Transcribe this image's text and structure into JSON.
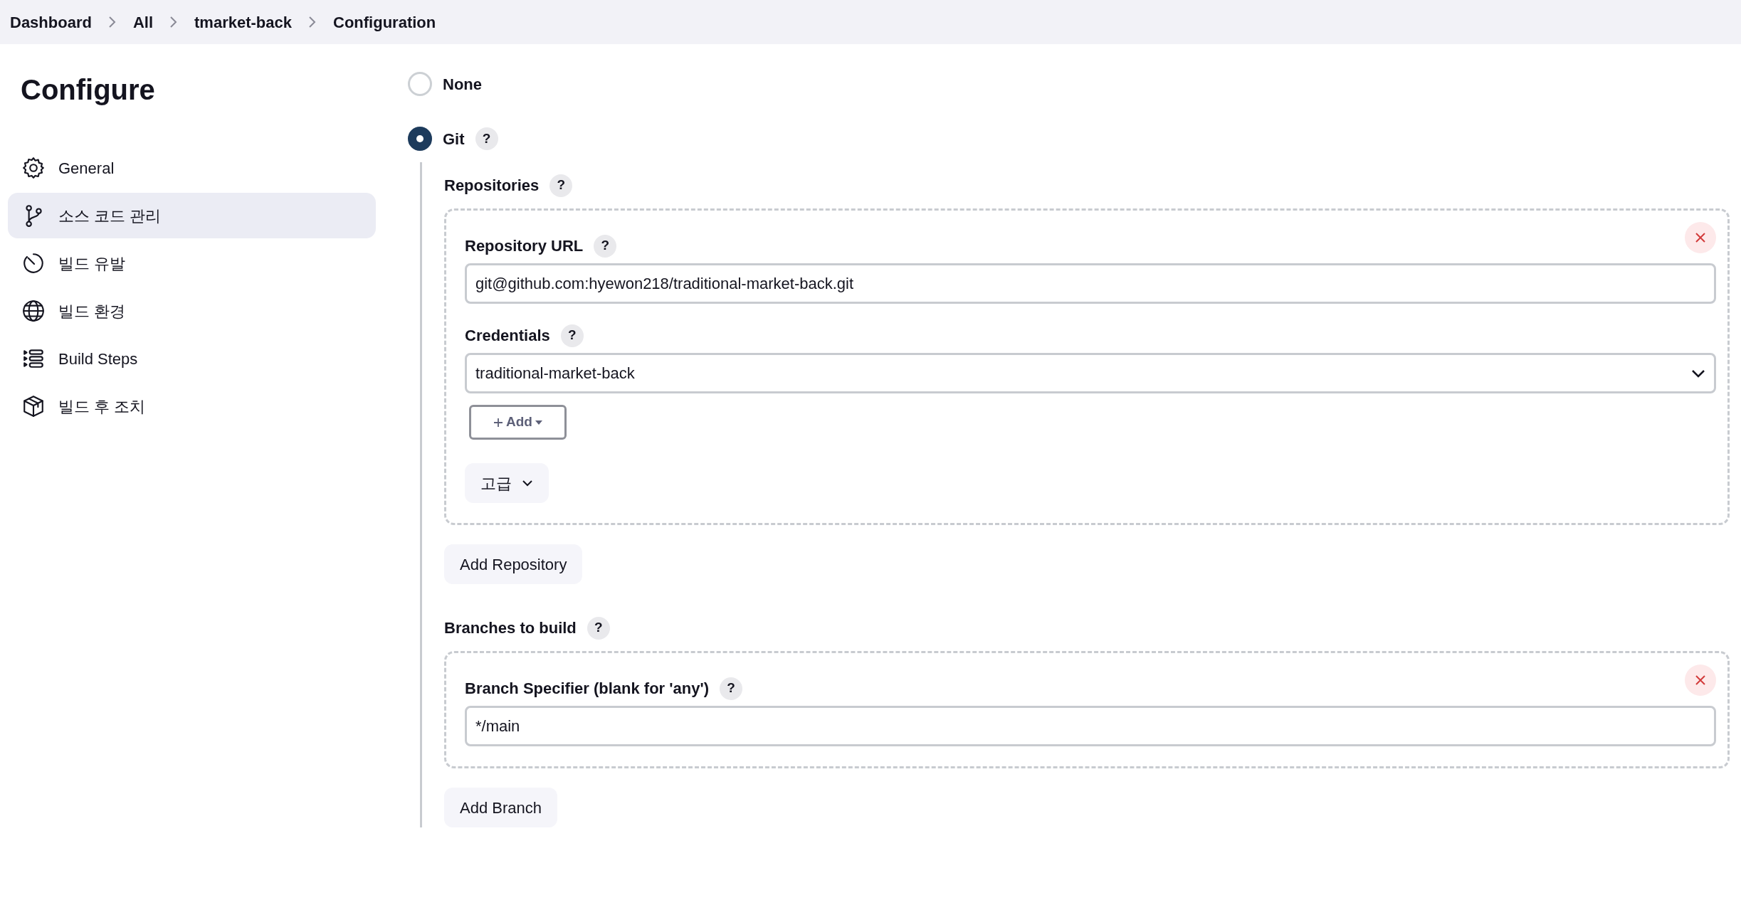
{
  "breadcrumbs": [
    {
      "label": "Dashboard"
    },
    {
      "label": "All"
    },
    {
      "label": "tmarket-back"
    },
    {
      "label": "Configuration"
    }
  ],
  "sidebar": {
    "title": "Configure",
    "items": [
      {
        "label": "General",
        "selected": false
      },
      {
        "label": "소스 코드 관리",
        "selected": true
      },
      {
        "label": "빌드 유발",
        "selected": false
      },
      {
        "label": "빌드 환경",
        "selected": false
      },
      {
        "label": "Build Steps",
        "selected": false
      },
      {
        "label": "빌드 후 조치",
        "selected": false
      }
    ]
  },
  "scm_options": [
    {
      "label": "None",
      "selected": false
    },
    {
      "label": "Git",
      "selected": true,
      "help": "?"
    }
  ],
  "git": {
    "repositories_label": "Repositories",
    "repositories_help": "?",
    "repositories": [
      {
        "url_label": "Repository URL",
        "url_help": "?",
        "url": "git@github.com:hyewon218/traditional-market-back.git",
        "credentials_label": "Credentials",
        "credentials_help": "?",
        "credentials": "traditional-market-back",
        "add_button": "Add",
        "advanced_button": "고급"
      }
    ],
    "add_repository_button": "Add Repository",
    "branches_label": "Branches to build",
    "branches_help": "?",
    "branches": [
      {
        "label": "Branch Specifier (blank for 'any')",
        "help": "?",
        "value": "*/main"
      }
    ],
    "add_branch_button": "Add Branch"
  }
}
